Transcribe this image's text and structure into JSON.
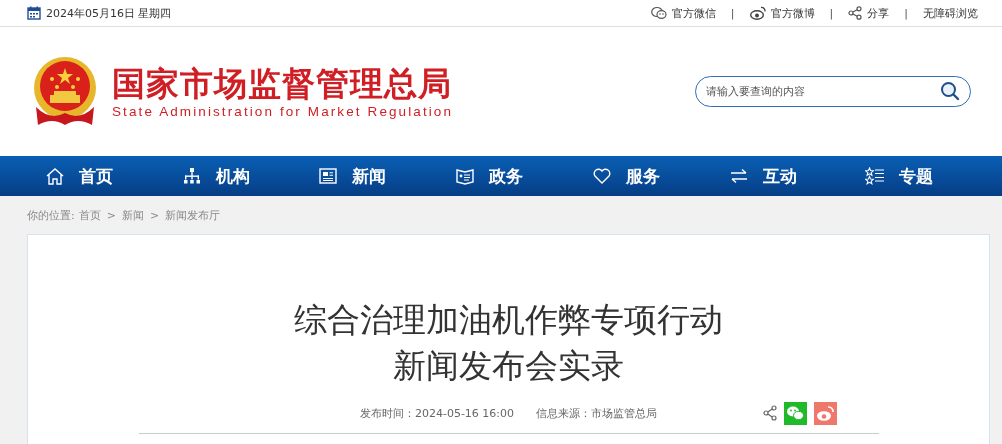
{
  "top_bar": {
    "date": "2024年05月16日 星期四",
    "separator": "|",
    "links": [
      {
        "label": "官方微信",
        "kind": "wechat"
      },
      {
        "label": "官方微博",
        "kind": "weibo"
      },
      {
        "label": "分享",
        "kind": "share"
      },
      {
        "label": "无障碍浏览",
        "kind": "plain"
      }
    ]
  },
  "logo": {
    "title": "国家市场监督管理总局",
    "subtitle": "State Administration for Market Regulation"
  },
  "search": {
    "placeholder": "请输入要查询的内容"
  },
  "nav": [
    {
      "label": "首页",
      "kind": "home"
    },
    {
      "label": "机构",
      "kind": "org"
    },
    {
      "label": "新闻",
      "kind": "news"
    },
    {
      "label": "政务",
      "kind": "gov"
    },
    {
      "label": "服务",
      "kind": "service"
    },
    {
      "label": "互动",
      "kind": "interact"
    },
    {
      "label": "专题",
      "kind": "topic"
    }
  ],
  "breadcrumb": {
    "prefix": "你的位置:",
    "separator": ">",
    "items": [
      "首页",
      "新闻",
      "新闻发布厅"
    ]
  },
  "article": {
    "title_lines": [
      "综合治理加油机作弊专项行动",
      "新闻发布会实录"
    ],
    "publish_time": "发布时间：2024-05-16 16:00",
    "source": "信息来源：市场监管总局"
  }
}
